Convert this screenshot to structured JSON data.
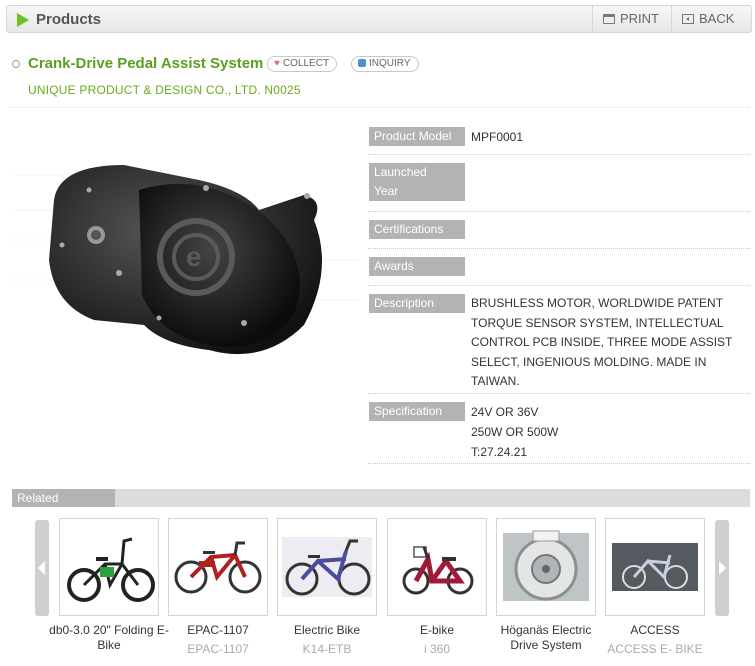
{
  "header": {
    "title": "Products",
    "print_label": "PRINT",
    "back_label": "BACK"
  },
  "product": {
    "title": "Crank-Drive Pedal Assist System",
    "collect_label": "COLLECT",
    "inquiry_label": "INQUIRY",
    "company": "UNIQUE PRODUCT & DESIGN CO., LTD. N0025"
  },
  "specs": [
    {
      "label": "Product Model",
      "value": "MPF0001"
    },
    {
      "label": "Launched\nYear",
      "value": ""
    },
    {
      "label": "Certifications",
      "value": ""
    },
    {
      "label": "Awards",
      "value": ""
    },
    {
      "label": "Description",
      "value": "BRUSHLESS MOTOR, WORLDWIDE PATENT TORQUE SENSOR SYSTEM, INTELLECTUAL CONTROL PCB INSIDE, THREE MODE ASSIST SELECT, INGENIOUS MOLDING. MADE IN TAIWAN."
    },
    {
      "label": "Specification",
      "value": "24V OR 36V\n250W OR 500W\nT:27.24.21"
    }
  ],
  "related": {
    "title": "Related",
    "items": [
      {
        "name": "db0-3.0 20\" Folding E-Bike",
        "model": ""
      },
      {
        "name": "EPAC-1107",
        "model": "EPAC-1107"
      },
      {
        "name": "Electric Bike",
        "model": "K14-ETB"
      },
      {
        "name": "E-bike",
        "model": "i 360"
      },
      {
        "name": "Höganäs Electric Drive System",
        "model": ""
      },
      {
        "name": "ACCESS",
        "model": "ACCESS E- BIKE"
      }
    ]
  }
}
